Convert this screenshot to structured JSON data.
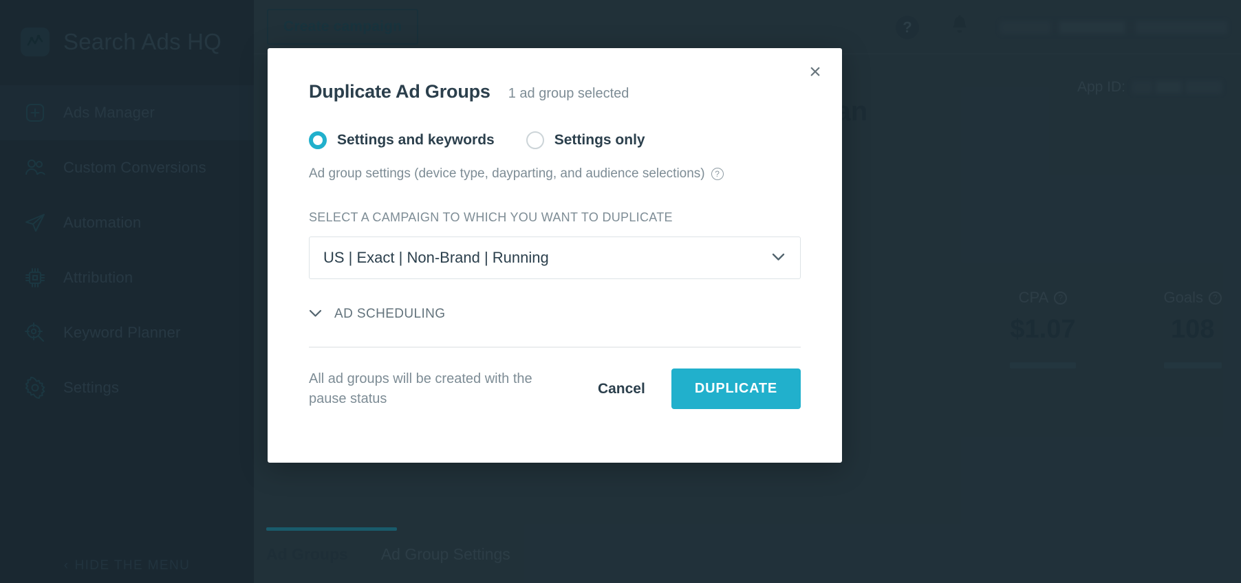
{
  "app": {
    "brand": "Search Ads HQ",
    "brand_icon": "chart-line-icon",
    "hide_menu": "HIDE THE MENU",
    "hide_menu_chevron": "‹"
  },
  "sidebar": {
    "items": [
      {
        "label": "Ads Manager",
        "icon": "plus-square-icon",
        "active": true
      },
      {
        "label": "Custom Conversions",
        "icon": "users-icon",
        "active": false
      },
      {
        "label": "Automation",
        "icon": "paper-plane-icon",
        "active": false
      },
      {
        "label": "Attribution",
        "icon": "chip-icon",
        "active": false
      },
      {
        "label": "Keyword Planner",
        "icon": "target-search-icon",
        "active": false
      },
      {
        "label": "Settings",
        "icon": "gear-icon",
        "active": false
      }
    ]
  },
  "topbar": {
    "create_campaign": "Create campaign",
    "help_icon": "question-circle-icon",
    "help_glyph": "?",
    "bell_icon": "bell-icon",
    "account_redacted": ""
  },
  "page": {
    "app_id_label": "App ID:",
    "app_id_value": "",
    "title_fragment": "plan",
    "metrics": [
      {
        "label": "CPA",
        "value": "$1.07",
        "info_icon": "question-circle-icon"
      },
      {
        "label": "Goals",
        "value": "108",
        "info_icon": "question-circle-icon"
      }
    ],
    "tabs": [
      {
        "label": "Ad Groups",
        "active": true
      },
      {
        "label": "Ad Group Settings",
        "active": false
      }
    ]
  },
  "modal": {
    "title": "Duplicate Ad Groups",
    "subtitle": "1 ad group selected",
    "close_icon": "close-icon",
    "close_glyph": "×",
    "options": [
      {
        "label": "Settings and keywords",
        "selected": true
      },
      {
        "label": "Settings only",
        "selected": false
      }
    ],
    "help_text": "Ad group settings (device type, dayparting, and audience selections)",
    "help_icon": "question-circle-icon",
    "help_glyph": "?",
    "select_label": "SELECT A CAMPAIGN TO WHICH YOU WANT TO DUPLICATE",
    "select_value": "US | Exact | Non-Brand | Running",
    "select_chevron": "⌄",
    "accordion_label": "AD SCHEDULING",
    "accordion_chevron": "⌄",
    "footer_note": "All ad groups will be created with the pause status",
    "cancel_label": "Cancel",
    "duplicate_label": "DUPLICATE"
  },
  "colors": {
    "accent": "#21b0cc",
    "sidebar_bg": "#22323d",
    "content_bg": "#31454f",
    "modal_bg": "#ffffff",
    "text_dark": "#2b3f4c",
    "text_muted": "#7d8c95"
  }
}
